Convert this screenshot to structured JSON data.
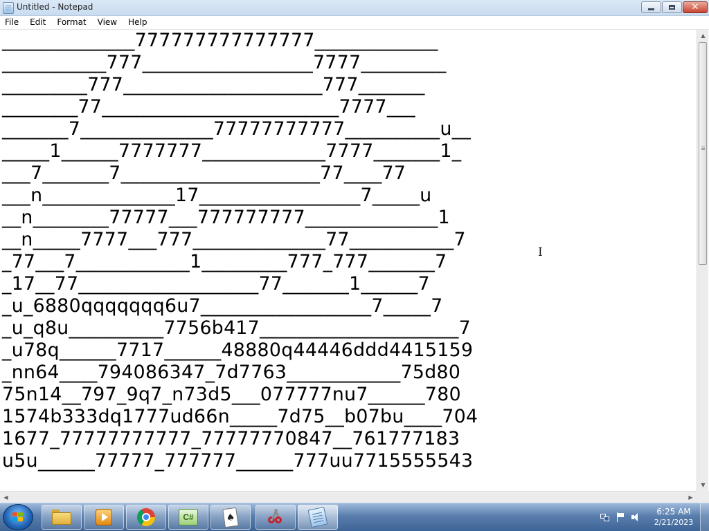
{
  "window": {
    "title": "Untitled - Notepad",
    "minimize_icon": "minimize-icon",
    "maximize_icon": "restore-icon",
    "close_icon": "close-icon",
    "close_glyph": "✕"
  },
  "menu": {
    "items": [
      "File",
      "Edit",
      "Format",
      "View",
      "Help"
    ]
  },
  "editor": {
    "lines": [
      "______________777777777777777_____________",
      "___________777__________________7777_________",
      "_________777_____________________777_______",
      "________77_________________________7777___",
      "_______7______________77777777777__________u__",
      "_____1______7777777_____________7777_______1_",
      "___7_______7_____________________77____77",
      "___n______________17_________________7_____u",
      "__n________77777___777777777______________1",
      "__n_____7777___777______________77___________7",
      "_77___7____________1_________777_777_______7",
      "_17__77___________________77_______1______7",
      "_u_6880qqqqqqq6u7__________________7_____7",
      "_u_q8u__________7756b417_____________________7",
      "_u78q______7717______48880q44446ddd4415159",
      "_nn64____794086347_7d7763____________75d80",
      "75n14__797_9q7_n73d5___077777nu7______780",
      "1574b333dq1777ud66n_____7d75__b07bu____704",
      "1677_77777777777_77777770847__761777183",
      "u5u______77777_777777______777uu7715555543"
    ]
  },
  "scrollbars": {
    "up_arrow": "▲",
    "down_arrow": "▼",
    "left_arrow": "◀",
    "right_arrow": "▶"
  },
  "taskbar": {
    "start_icon": "windows-start-icon",
    "pinned": [
      {
        "name": "file-explorer-icon"
      },
      {
        "name": "media-player-icon"
      },
      {
        "name": "chrome-icon"
      },
      {
        "name": "csharp-project-icon",
        "label": "C#"
      },
      {
        "name": "solitaire-icon",
        "label": "♠"
      },
      {
        "name": "snipping-tool-icon"
      },
      {
        "name": "notepad-icon"
      }
    ],
    "tray": {
      "time": "6:25 AM",
      "date": "2/21/2023"
    }
  },
  "colors": {
    "title_bar": "#c9dcf0",
    "close_button": "#c9452f",
    "taskbar": "#3d6496",
    "editor_bg": "#ffffff"
  }
}
